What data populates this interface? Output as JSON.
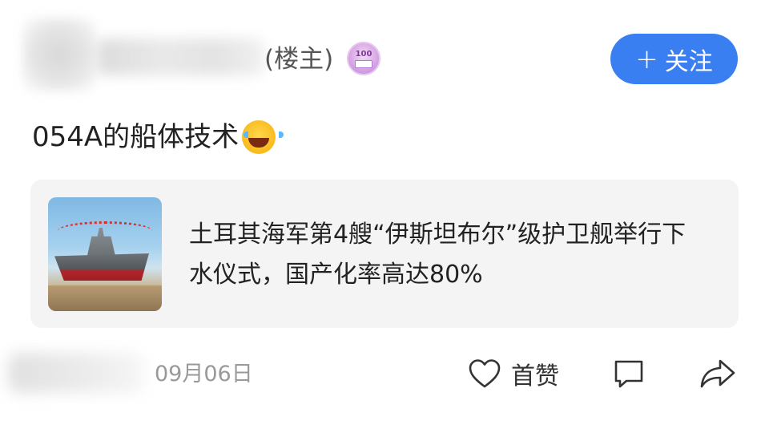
{
  "author": {
    "owner_tag": "(楼主)",
    "level_badge_text": "100"
  },
  "follow_button": {
    "label": "关注",
    "icon": "plus-icon"
  },
  "post": {
    "text": "054A的船体技术",
    "emoji": "laughing-tears-emoji"
  },
  "link_card": {
    "title": "土耳其海军第4艘“伊斯坦布尔”级护卫舰举行下水仪式，国产化率高达80%",
    "thumbnail": "warship-launch-image"
  },
  "footer": {
    "date": "09月06日",
    "like_label": "首赞",
    "like_icon": "heart-icon",
    "comment_icon": "comment-icon",
    "share_icon": "share-icon"
  },
  "colors": {
    "accent": "#3a7ff2",
    "card_bg": "#f4f4f5",
    "muted_text": "#999999"
  }
}
